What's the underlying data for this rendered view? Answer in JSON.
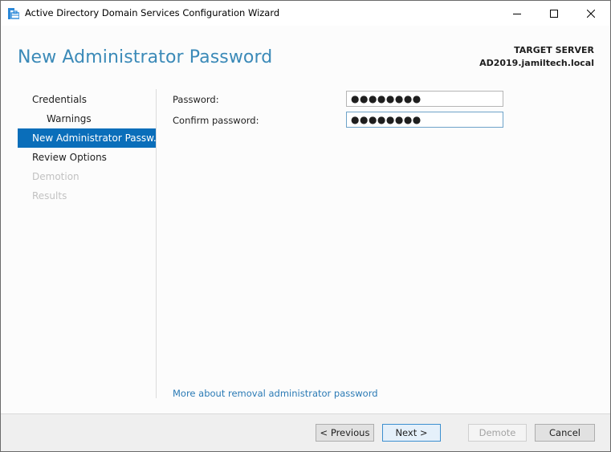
{
  "window": {
    "title": "Active Directory Domain Services Configuration Wizard",
    "icon": "ad-ds-wizard-icon",
    "controls": {
      "minimize": "minimize-icon",
      "maximize": "maximize-icon",
      "close": "close-icon"
    }
  },
  "header": {
    "page_title": "New Administrator Password",
    "target_server_label": "TARGET SERVER",
    "target_server_value": "AD2019.jamiltech.local"
  },
  "nav": {
    "items": [
      {
        "label": "Credentials",
        "state": "normal",
        "level": 0
      },
      {
        "label": "Warnings",
        "state": "normal",
        "level": 1
      },
      {
        "label": "New Administrator Passw...",
        "state": "active",
        "level": 0
      },
      {
        "label": "Review Options",
        "state": "normal",
        "level": 0
      },
      {
        "label": "Demotion",
        "state": "disabled",
        "level": 0
      },
      {
        "label": "Results",
        "state": "disabled",
        "level": 0
      }
    ]
  },
  "form": {
    "password_label": "Password:",
    "password_value": "●●●●●●●●",
    "confirm_label": "Confirm password:",
    "confirm_value": "●●●●●●●●"
  },
  "help_link": "More about removal administrator password",
  "buttons": {
    "previous": "< Previous",
    "next": "Next >",
    "demote": "Demote",
    "cancel": "Cancel"
  }
}
